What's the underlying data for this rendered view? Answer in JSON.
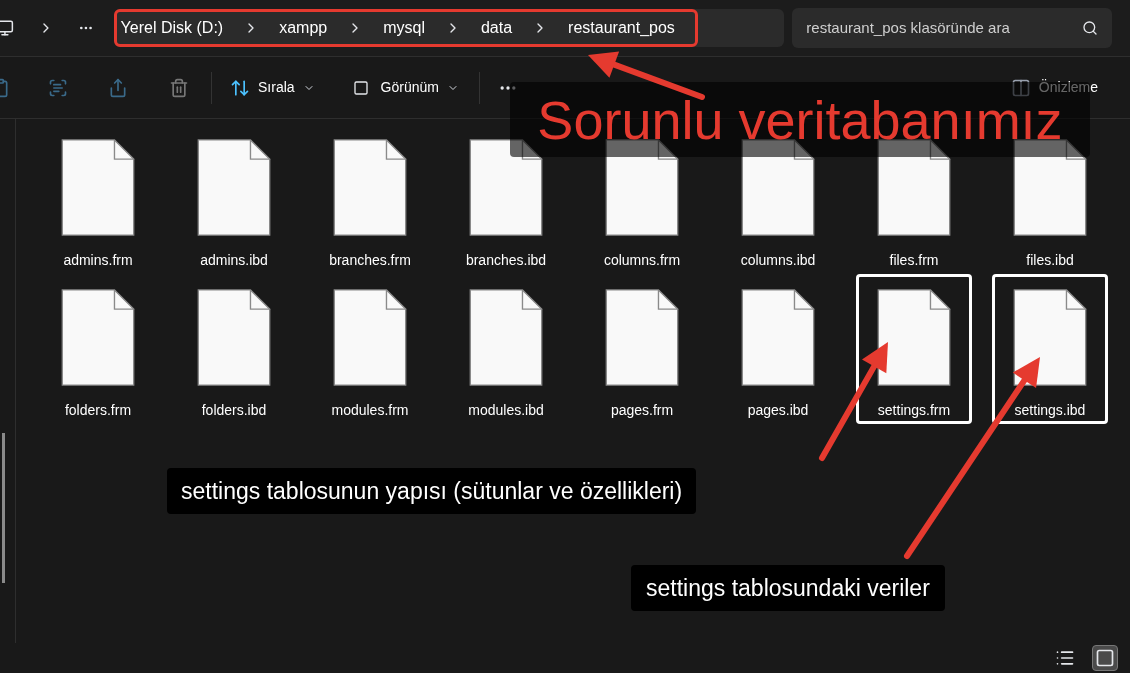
{
  "address_bar": {
    "path": [
      "Yerel Disk (D:)",
      "xampp",
      "mysql",
      "data",
      "restaurant_pos"
    ]
  },
  "search": {
    "placeholder": "restaurant_pos klasöründe ara"
  },
  "toolbar": {
    "sort_label": "Sırala",
    "view_label": "Görünüm",
    "preview_label": "Önizleme"
  },
  "files": [
    {
      "name": "admins.frm",
      "highlighted": false
    },
    {
      "name": "admins.ibd",
      "highlighted": false
    },
    {
      "name": "branches.frm",
      "highlighted": false
    },
    {
      "name": "branches.ibd",
      "highlighted": false
    },
    {
      "name": "columns.frm",
      "highlighted": false
    },
    {
      "name": "columns.ibd",
      "highlighted": false
    },
    {
      "name": "files.frm",
      "highlighted": false
    },
    {
      "name": "files.ibd",
      "highlighted": false
    },
    {
      "name": "folders.frm",
      "highlighted": false
    },
    {
      "name": "folders.ibd",
      "highlighted": false
    },
    {
      "name": "modules.frm",
      "highlighted": false
    },
    {
      "name": "modules.ibd",
      "highlighted": false
    },
    {
      "name": "pages.frm",
      "highlighted": false
    },
    {
      "name": "pages.ibd",
      "highlighted": false
    },
    {
      "name": "settings.frm",
      "highlighted": true
    },
    {
      "name": "settings.ibd",
      "highlighted": true
    }
  ],
  "annotations": {
    "title": "Sorunlu veritabanımız",
    "callouts": [
      "settings tablosunun yapısı (sütunlar ve özellikleri)",
      "settings tablosundaki veriler"
    ]
  },
  "view_buttons": [
    {
      "kind": "details",
      "selected": false
    },
    {
      "kind": "large_icons",
      "selected": true
    }
  ]
}
